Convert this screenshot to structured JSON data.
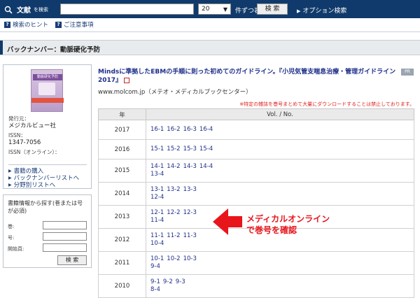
{
  "topbar": {
    "brand": "文献",
    "brand_small": "を検索",
    "perpage": "20",
    "perpage_label": "件ずつ表示",
    "search_button": "検 索",
    "option_link": "オプション検索"
  },
  "subnav": {
    "hint": "検索のヒント",
    "notes": "ご注意事項"
  },
  "section": {
    "title": "バックナンバー：動脈硬化予防"
  },
  "book": {
    "publisher_label": "発行元：",
    "publisher": "メジカルビュー社",
    "issn_label": "ISSN：",
    "issn": "1347-7056",
    "issn_online_label": "ISSN（オンライン）：",
    "links": [
      "書籍の購入",
      "バックナンバーリストへ",
      "分野別リストへ"
    ]
  },
  "cover": {
    "title": "動脈硬化予防"
  },
  "left_search": {
    "title": "書籍情報から探す(巻または号が必須)",
    "vol_label": "巻:",
    "no_label": "号:",
    "page_label": "開始頁:",
    "button": "検 索"
  },
  "pr": {
    "title": "Mindsに準拠したEBMの手順に則った初めてのガイドライン。『小児気管支喘息治療・管理ガイドライン2017』",
    "url": "www.molcom.jp（メテオ・メディカルブックセンター）",
    "badge": "PR"
  },
  "warning": "※特定の雑誌を巻号まとめて大量にダウンロードすることは禁止しております。",
  "table": {
    "col_year": "年",
    "col_vol": "Vol. / No.",
    "rows": [
      {
        "year": "2017",
        "lines": [
          [
            "16-1",
            "16-2",
            "16-3",
            "16-4"
          ]
        ]
      },
      {
        "year": "2016",
        "lines": [
          [
            "15-1",
            "15-2",
            "15-3",
            "15-4"
          ]
        ]
      },
      {
        "year": "2015",
        "lines": [
          [
            "14-1",
            "14-2",
            "14-3",
            "14-4"
          ],
          [
            "13-4"
          ]
        ]
      },
      {
        "year": "2014",
        "lines": [
          [
            "13-1",
            "13-2",
            "13-3"
          ],
          [
            "12-4"
          ]
        ]
      },
      {
        "year": "2013",
        "lines": [
          [
            "12-1",
            "12-2",
            "12-3"
          ],
          [
            "11-4"
          ]
        ]
      },
      {
        "year": "2012",
        "lines": [
          [
            "11-1",
            "11-2",
            "11-3"
          ],
          [
            "10-4"
          ]
        ]
      },
      {
        "year": "2011",
        "lines": [
          [
            "10-1",
            "10-2",
            "10-3"
          ],
          [
            "9-4"
          ]
        ]
      },
      {
        "year": "2010",
        "lines": [
          [
            "9-1",
            "9-2",
            "9-3"
          ],
          [
            "8-4"
          ]
        ]
      }
    ]
  },
  "callout": {
    "line1": "メディカルオンライン",
    "line2": "で巻号を確認"
  }
}
